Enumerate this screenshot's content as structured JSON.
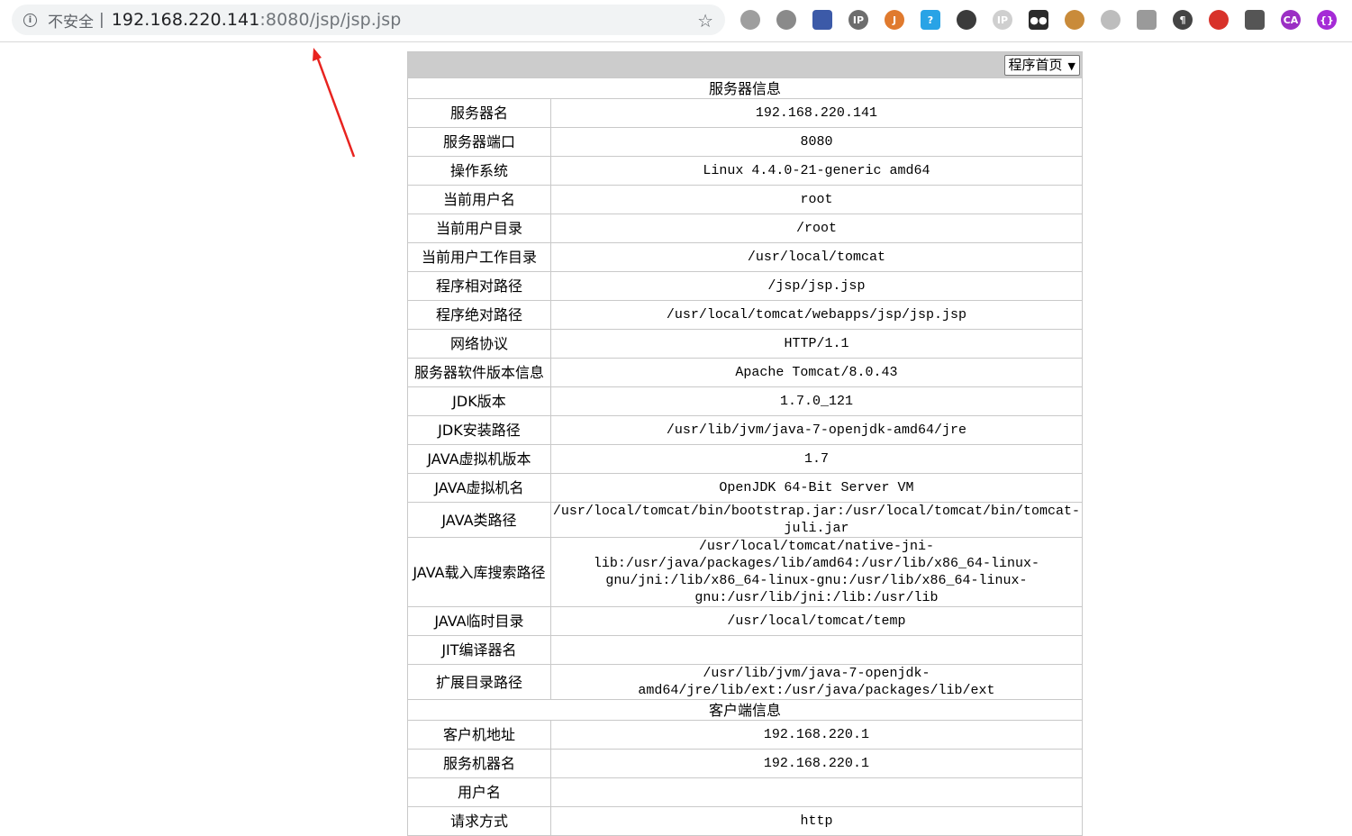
{
  "browser": {
    "security_label": "不安全",
    "url_host": "192.168.220.141",
    "url_rest": ":8080/jsp/jsp.jsp",
    "extensions": [
      {
        "name": "globe-extension-icon",
        "color": "#9e9e9e",
        "glyph": ""
      },
      {
        "name": "link-extension-icon",
        "color": "#8a8a8a",
        "glyph": ""
      },
      {
        "name": "flag-extension-icon",
        "color": "#3c5aa8",
        "glyph": ""
      },
      {
        "name": "ip-lookup-extension-icon",
        "color": "#6d6d6d",
        "glyph": "IP"
      },
      {
        "name": "java-extension-icon",
        "color": "#e07a2e",
        "glyph": "J"
      },
      {
        "name": "chat-extension-icon",
        "color": "#29a3e6",
        "glyph": "?"
      },
      {
        "name": "incognito-extension-icon",
        "color": "#3b3b3b",
        "glyph": ""
      },
      {
        "name": "ip-extension-icon",
        "color": "#cfcfcf",
        "glyph": "IP"
      },
      {
        "name": "tampermonkey-extension-icon",
        "color": "#2b2b2b",
        "glyph": "●●"
      },
      {
        "name": "cookie-extension-icon",
        "color": "#c98b3a",
        "glyph": ""
      },
      {
        "name": "wave-extension-icon",
        "color": "#bdbdbd",
        "glyph": ""
      },
      {
        "name": "wave-extension-icon-2",
        "color": "#9a9a9a",
        "glyph": ""
      },
      {
        "name": "paragraph-extension-icon",
        "color": "#444444",
        "glyph": "¶"
      },
      {
        "name": "diamond-extension-icon",
        "color": "#d8322a",
        "glyph": ""
      },
      {
        "name": "shield-extension-icon",
        "color": "#555555",
        "glyph": ""
      },
      {
        "name": "ca-extension-icon",
        "color": "#9b2fc4",
        "glyph": "CA"
      },
      {
        "name": "code-extension-icon",
        "color": "#a52bd6",
        "glyph": "{}"
      }
    ]
  },
  "page": {
    "nav_select_value": "程序首页",
    "server_section_title": "服务器信息",
    "server_rows": [
      {
        "label": "服务器名",
        "value": "192.168.220.141"
      },
      {
        "label": "服务器端口",
        "value": "8080"
      },
      {
        "label": "操作系统",
        "value": "Linux 4.4.0-21-generic amd64"
      },
      {
        "label": "当前用户名",
        "value": "root"
      },
      {
        "label": "当前用户目录",
        "value": "/root"
      },
      {
        "label": "当前用户工作目录",
        "value": "/usr/local/tomcat"
      },
      {
        "label": "程序相对路径",
        "value": "/jsp/jsp.jsp"
      },
      {
        "label": "程序绝对路径",
        "value": "/usr/local/tomcat/webapps/jsp/jsp.jsp"
      },
      {
        "label": "网络协议",
        "value": "HTTP/1.1"
      },
      {
        "label": "服务器软件版本信息",
        "value": "Apache Tomcat/8.0.43"
      },
      {
        "label": "JDK版本",
        "value": "1.7.0_121"
      },
      {
        "label": "JDK安装路径",
        "value": "/usr/lib/jvm/java-7-openjdk-amd64/jre"
      },
      {
        "label": "JAVA虚拟机版本",
        "value": "1.7"
      },
      {
        "label": "JAVA虚拟机名",
        "value": "OpenJDK 64-Bit Server VM"
      }
    ],
    "classpath_row": {
      "label": "JAVA类路径",
      "value_lines": [
        "/usr/local/tomcat/bin/bootstrap.jar:/usr/local/tomcat/bin/tomcat-",
        "juli.jar"
      ]
    },
    "libpath_row": {
      "label": "JAVA载入库搜索路径",
      "value_lines": [
        "/usr/local/tomcat/native-jni-",
        "lib:/usr/java/packages/lib/amd64:/usr/lib/x86_64-linux-",
        "gnu/jni:/lib/x86_64-linux-gnu:/usr/lib/x86_64-linux-",
        "gnu:/usr/lib/jni:/lib:/usr/lib"
      ]
    },
    "tmpdir_row": {
      "label": "JAVA临时目录",
      "value": "/usr/local/tomcat/temp"
    },
    "jit_row": {
      "label": "JIT编译器名",
      "value": ""
    },
    "ext_row": {
      "label": "扩展目录路径",
      "value_lines": [
        "/usr/lib/jvm/java-7-openjdk-",
        "amd64/jre/lib/ext:/usr/java/packages/lib/ext"
      ]
    },
    "client_section_title": "客户端信息",
    "client_rows": [
      {
        "label": "客户机地址",
        "value": "192.168.220.1"
      },
      {
        "label": "服务机器名",
        "value": "192.168.220.1"
      },
      {
        "label": "用户名",
        "value": ""
      }
    ],
    "partial_row": {
      "label": "请求方式",
      "value": "http"
    }
  }
}
